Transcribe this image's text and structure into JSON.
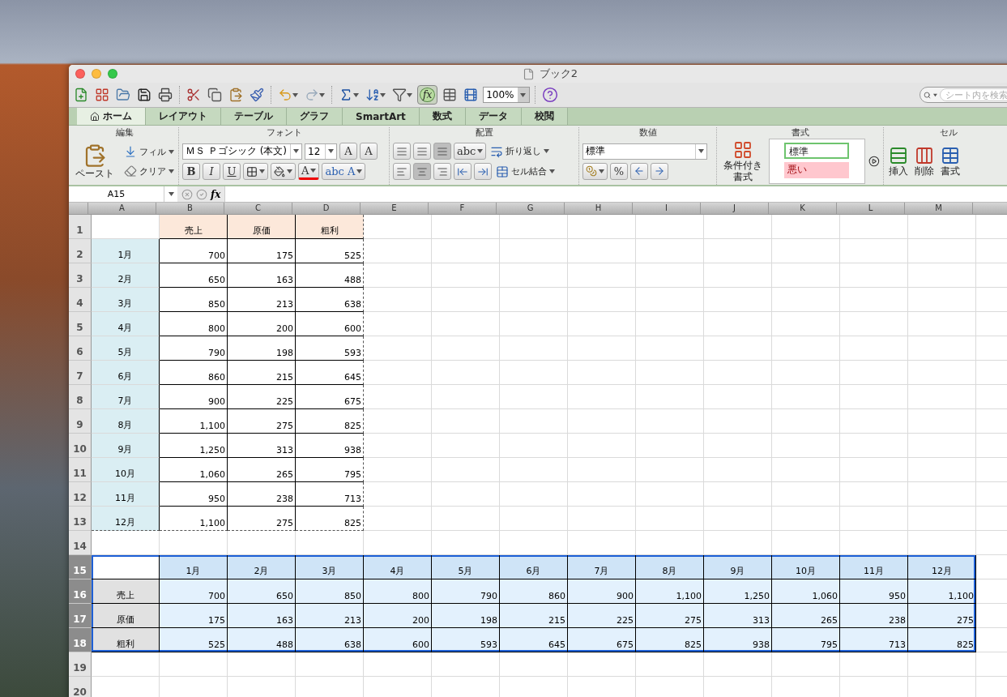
{
  "window": {
    "title": "ブック2"
  },
  "toolbar": {
    "fx": "fx",
    "zoom": "100%",
    "search": {
      "placeholder": "シート内を検索"
    }
  },
  "tabs": [
    {
      "label": "ホーム",
      "selected": true
    },
    {
      "label": "レイアウト",
      "selected": false
    },
    {
      "label": "テーブル",
      "selected": false
    },
    {
      "label": "グラフ",
      "selected": false
    },
    {
      "label": "SmartArt",
      "selected": false
    },
    {
      "label": "数式",
      "selected": false
    },
    {
      "label": "データ",
      "selected": false
    },
    {
      "label": "校閲",
      "selected": false
    }
  ],
  "ribbon": {
    "edit": {
      "title": "編集",
      "paste": "ペースト",
      "fill": "フィル",
      "clear": "クリア"
    },
    "font": {
      "title": "フォント",
      "font_name": "ＭＳ Ｐゴシック (本文)",
      "size": "12",
      "grow": "A",
      "shrink": "A",
      "bold": "B",
      "italic": "I",
      "underline": "U",
      "font_color": "A",
      "art_small": "abc",
      "art_large": "A"
    },
    "align": {
      "title": "配置",
      "orientation": "abc",
      "wrap": "折り返し",
      "merge": "セル結合"
    },
    "number": {
      "title": "数値",
      "format": "標準",
      "percent": "%"
    },
    "styles": {
      "title": "書式",
      "conditional": "条件付き書式",
      "gallery": [
        {
          "label": "標準",
          "color": "#ffffff"
        },
        {
          "label": "悪い",
          "color": "#ffc7ce"
        }
      ]
    },
    "cells": {
      "title": "セル",
      "insert": "挿入",
      "delete": "削除",
      "format": "書式"
    }
  },
  "formula_bar": {
    "name_box": "A15",
    "fx": "fx"
  },
  "sheet": {
    "columns": [
      "A",
      "B",
      "C",
      "D",
      "E",
      "F",
      "G",
      "H",
      "I",
      "J",
      "K",
      "L",
      "M"
    ],
    "rows": [
      {
        "label": "1",
        "kind": "head",
        "selected": false,
        "cells": {
          "B": "売上",
          "C": "原価",
          "D": "粗利"
        }
      },
      {
        "label": "2",
        "kind": "body",
        "selected": false,
        "cells": {
          "A": "1月",
          "B": "700",
          "C": "175",
          "D": "525"
        }
      },
      {
        "label": "3",
        "kind": "body",
        "selected": false,
        "cells": {
          "A": "2月",
          "B": "650",
          "C": "163",
          "D": "488"
        }
      },
      {
        "label": "4",
        "kind": "body",
        "selected": false,
        "cells": {
          "A": "3月",
          "B": "850",
          "C": "213",
          "D": "638"
        }
      },
      {
        "label": "5",
        "kind": "body",
        "selected": false,
        "cells": {
          "A": "4月",
          "B": "800",
          "C": "200",
          "D": "600"
        }
      },
      {
        "label": "6",
        "kind": "body",
        "selected": false,
        "cells": {
          "A": "5月",
          "B": "790",
          "C": "198",
          "D": "593"
        }
      },
      {
        "label": "7",
        "kind": "body",
        "selected": false,
        "cells": {
          "A": "6月",
          "B": "860",
          "C": "215",
          "D": "645"
        }
      },
      {
        "label": "8",
        "kind": "body",
        "selected": false,
        "cells": {
          "A": "7月",
          "B": "900",
          "C": "225",
          "D": "675"
        }
      },
      {
        "label": "9",
        "kind": "body",
        "selected": false,
        "cells": {
          "A": "8月",
          "B": "1,100",
          "C": "275",
          "D": "825"
        }
      },
      {
        "label": "10",
        "kind": "body",
        "selected": false,
        "cells": {
          "A": "9月",
          "B": "1,250",
          "C": "313",
          "D": "938"
        }
      },
      {
        "label": "11",
        "kind": "body",
        "selected": false,
        "cells": {
          "A": "10月",
          "B": "1,060",
          "C": "265",
          "D": "795"
        }
      },
      {
        "label": "12",
        "kind": "body",
        "selected": false,
        "cells": {
          "A": "11月",
          "B": "950",
          "C": "238",
          "D": "713"
        }
      },
      {
        "label": "13",
        "kind": "end",
        "selected": false,
        "cells": {
          "A": "12月",
          "B": "1,100",
          "C": "275",
          "D": "825"
        }
      },
      {
        "label": "14",
        "kind": "blank",
        "selected": false,
        "cells": {}
      },
      {
        "label": "15",
        "kind": "cross-head",
        "selected": true,
        "cells": {
          "B": "1月",
          "C": "2月",
          "D": "3月",
          "E": "4月",
          "F": "5月",
          "G": "6月",
          "H": "7月",
          "I": "8月",
          "J": "9月",
          "K": "10月",
          "L": "11月",
          "M": "12月"
        }
      },
      {
        "label": "16",
        "kind": "cross-body",
        "selected": true,
        "cells": {
          "A": "売上",
          "B": "700",
          "C": "650",
          "D": "850",
          "E": "800",
          "F": "790",
          "G": "860",
          "H": "900",
          "I": "1,100",
          "J": "1,250",
          "K": "1,060",
          "L": "950",
          "M": "1,100"
        }
      },
      {
        "label": "17",
        "kind": "cross-body",
        "selected": true,
        "cells": {
          "A": "原価",
          "B": "175",
          "C": "163",
          "D": "213",
          "E": "200",
          "F": "198",
          "G": "215",
          "H": "225",
          "I": "275",
          "J": "313",
          "K": "265",
          "L": "238",
          "M": "275"
        }
      },
      {
        "label": "18",
        "kind": "cross-body",
        "selected": true,
        "cells": {
          "A": "粗利",
          "B": "525",
          "C": "488",
          "D": "638",
          "E": "600",
          "F": "593",
          "G": "645",
          "H": "675",
          "I": "825",
          "J": "938",
          "K": "795",
          "L": "713",
          "M": "825"
        }
      },
      {
        "label": "19",
        "kind": "blank",
        "selected": false,
        "cells": {}
      },
      {
        "label": "20",
        "kind": "blank",
        "selected": false,
        "cells": {}
      }
    ]
  }
}
